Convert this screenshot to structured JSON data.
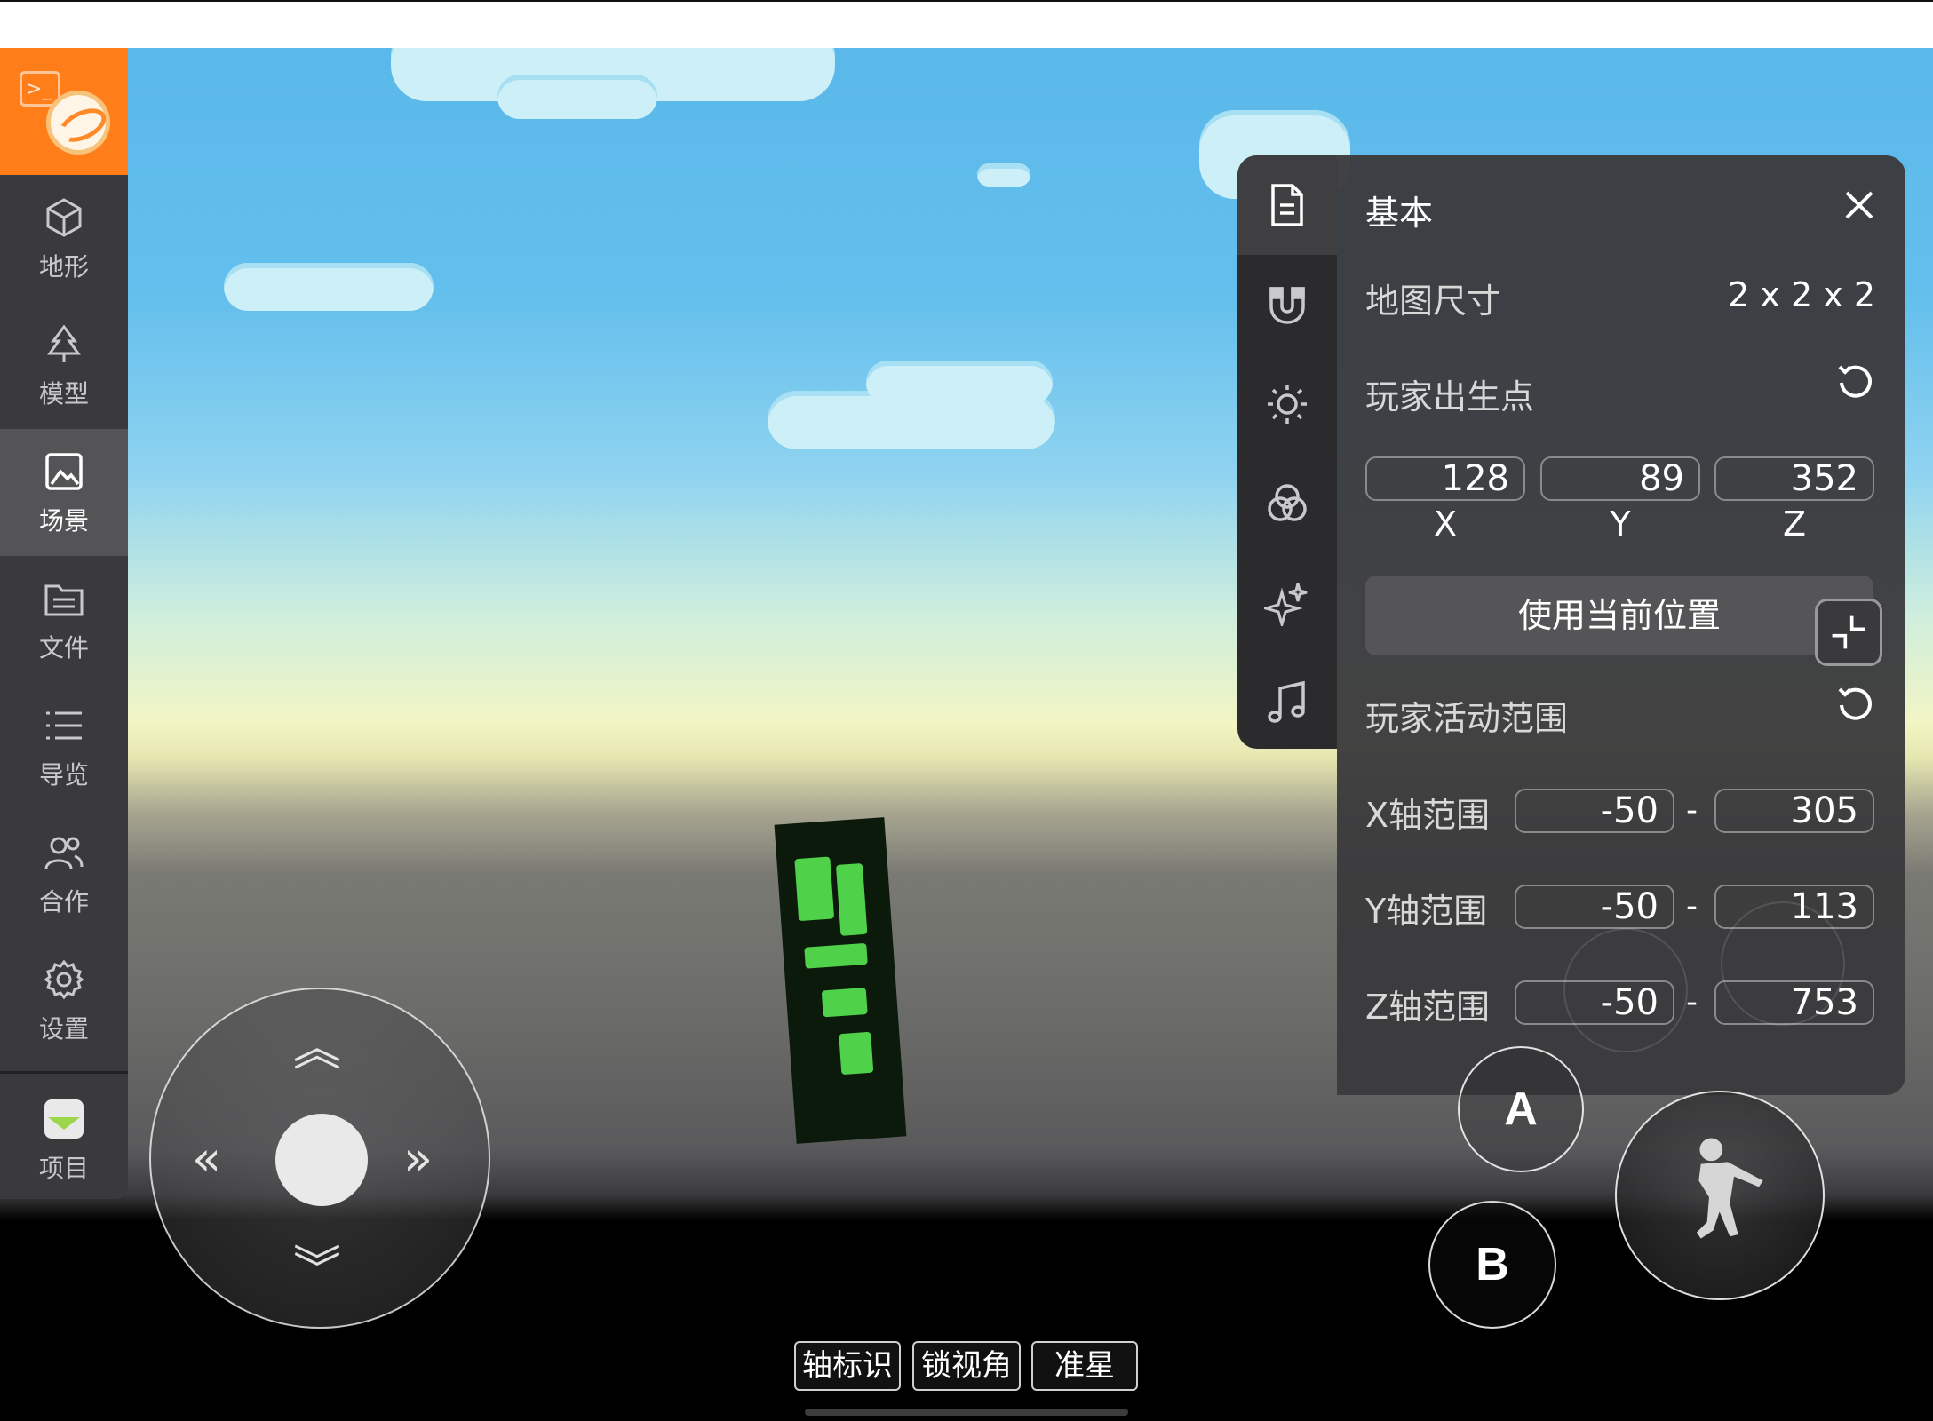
{
  "sidebar": {
    "items": [
      {
        "label": "地形",
        "icon": "cube-icon"
      },
      {
        "label": "模型",
        "icon": "tree-icon"
      },
      {
        "label": "场景",
        "icon": "image-icon"
      },
      {
        "label": "文件",
        "icon": "folder-icon"
      },
      {
        "label": "导览",
        "icon": "list-icon"
      },
      {
        "label": "合作",
        "icon": "users-icon"
      },
      {
        "label": "设置",
        "icon": "gear-icon"
      },
      {
        "label": "项目",
        "icon": "project-icon"
      }
    ],
    "active": "场景"
  },
  "panel": {
    "title": "基本",
    "map_size_label": "地图尺寸",
    "map_size_value": "2 x 2 x 2",
    "spawn_label": "玩家出生点",
    "spawn": {
      "x": "128",
      "y": "89",
      "z": "352"
    },
    "axis_labels": {
      "x": "X",
      "y": "Y",
      "z": "Z"
    },
    "use_current_position": "使用当前位置",
    "range_label": "玩家活动范围",
    "ranges": [
      {
        "label": "X轴范围",
        "min": "-50",
        "max": "305"
      },
      {
        "label": "Y轴范围",
        "min": "-50",
        "max": "113"
      },
      {
        "label": "Z轴范围",
        "min": "-50",
        "max": "753"
      }
    ],
    "range_separator": "-",
    "tabs": [
      "document-icon",
      "magnet-icon",
      "sun-icon",
      "color-circles-icon",
      "sparkle-icon",
      "music-icon"
    ]
  },
  "controls": {
    "a_label": "A",
    "b_label": "B"
  },
  "bottom_bar": {
    "axis_marker": "轴标识",
    "lock_view": "锁视角",
    "crosshair": "准星"
  }
}
